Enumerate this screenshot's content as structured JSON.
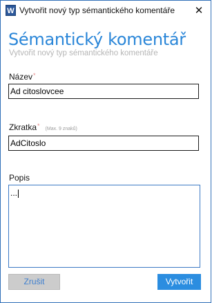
{
  "window": {
    "title": "Vytvořit nový typ sémantického komentáře",
    "app_icon_letter": "W",
    "close_glyph": "✕"
  },
  "dialog": {
    "heading": "Sémantický komentář",
    "subheading": "Vytvořit nový typ sémantického komentáře"
  },
  "fields": {
    "name": {
      "label": "Název",
      "required_mark": "*",
      "value": "Ad citoslovcee"
    },
    "abbreviation": {
      "label": "Zkratka",
      "required_mark": "*",
      "hint": "(Max. 9 znaků)",
      "value": "AdCitoslo"
    },
    "description": {
      "label": "Popis",
      "value": "..."
    }
  },
  "buttons": {
    "cancel": "Zrušit",
    "create": "Vytvořit"
  },
  "colors": {
    "accent": "#2a86d8",
    "primary_button": "#2b8de0",
    "disabled_button": "#cccccc",
    "required_mark": "#e58a8a",
    "window_border": "#2f6fb8"
  }
}
